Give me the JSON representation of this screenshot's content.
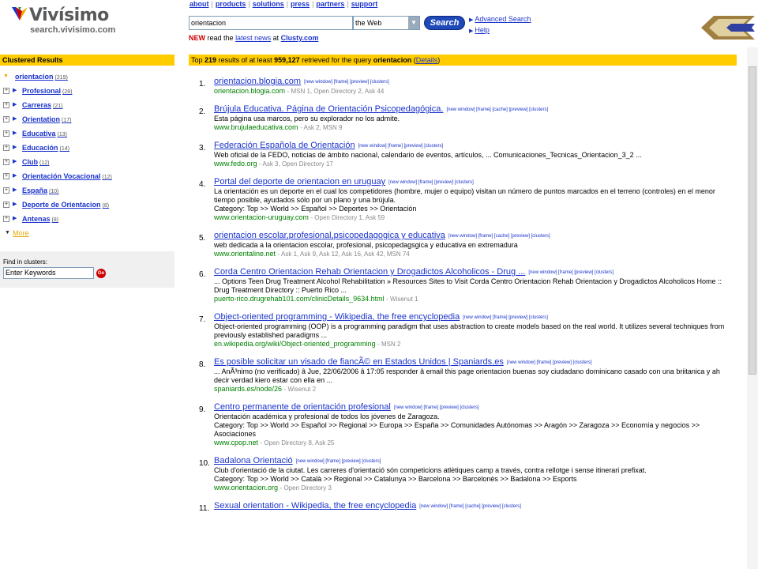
{
  "brand": {
    "name": "Vivísimo",
    "subdomain": "search.vivisimo.com"
  },
  "topnav": [
    "about",
    "products",
    "solutions",
    "press",
    "partners",
    "support"
  ],
  "search": {
    "query": "orientacion",
    "scope": "the Web",
    "button": "Search"
  },
  "side_links": [
    "Advanced Search",
    "Help"
  ],
  "news": {
    "new_label": "NEW",
    "prefix": "read the",
    "link": "latest news",
    "at": "at",
    "site": "Clusty.com"
  },
  "sidebar": {
    "header": "Clustered Results",
    "root": {
      "label": "orientacion",
      "count": "(219)"
    },
    "clusters": [
      {
        "label": "Profesional",
        "count": "(28)"
      },
      {
        "label": "Carreras",
        "count": "(21)"
      },
      {
        "label": "Orientation",
        "count": "(17)"
      },
      {
        "label": "Educativa",
        "count": "(13)"
      },
      {
        "label": "Educación",
        "count": "(14)"
      },
      {
        "label": "Club",
        "count": "(12)"
      },
      {
        "label": "Orientación Vocacional",
        "count": "(12)"
      },
      {
        "label": "España",
        "count": "(10)"
      },
      {
        "label": "Deporte de Orientacion",
        "count": "(8)"
      },
      {
        "label": "Antenas",
        "count": "(8)"
      }
    ],
    "more": "More",
    "find_label": "Find in clusters:",
    "find_placeholder": "Enter Keywords"
  },
  "results_header": {
    "prefix": "Top",
    "top": "219",
    "mid": "results of at least",
    "total": "959,127",
    "suffix": "retrieved for the query",
    "query": "orientacion",
    "details": "Details"
  },
  "results": [
    {
      "num": "1.",
      "title": "orientacion.blogia.com",
      "links": "[new window] [frame] [preview] [clusters]",
      "snippet": "",
      "url": "orientacion.blogia.com",
      "sources": "- MSN 1, Open Directory 2, Ask 44"
    },
    {
      "num": "2.",
      "title": "Brújula Educativa. Página de Orientación Psicopedagógica.",
      "links": "[new window] [frame] [cache] [preview] [clusters]",
      "snippet": "Esta página usa marcos, pero su explorador no los admite.",
      "url": "www.brujulaeducativa.com",
      "sources": "- Ask 2, MSN 9"
    },
    {
      "num": "3.",
      "title": "Federación Española de Orientación",
      "links": "[new window] [frame] [preview] [clusters]",
      "snippet": "Web oficial de la FEDO, noticias de ámbito nacional, calendario de eventos, artículos, ... Comunicaciones_Tecnicas_Orientacion_3_2 ...",
      "url": "www.fedo.org",
      "sources": "- Ask 3, Open Directory 17"
    },
    {
      "num": "4.",
      "title": "Portal del deporte de orientacion en uruguay",
      "links": "[new window] [frame] [preview] [clusters]",
      "snippet": "La orientación es un deporte en el cual los competidores (hombre, mujer o equipo) visitan un número de puntos marcados en el terreno (controles) en el menor tiempo posible, ayudados sólo por un plano y una brújula.",
      "category": "Category: Top >> World >> Español >> Deportes >> Orientación",
      "url": "www.orientacion-uruguay.com",
      "sources": "- Open Directory 1, Ask 59"
    },
    {
      "num": "5.",
      "title": "orientacion escolar,profesional,psicopedagogica y educativa",
      "links": "[new window] [frame] [cache] [preview] [clusters]",
      "snippet": "web dedicada a la orientacion escolar, profesional, psicopedagsgica y educativa en extremadura",
      "url": "www.orientaline.net",
      "sources": "- Ask 1, Ask 9, Ask 12, Ask 16, Ask 42, MSN 74"
    },
    {
      "num": "6.",
      "title": "Corda Centro Orientacion Rehab Orientacion y Drogadictos Alcoholicos - Drug ...",
      "links": "[new window] [frame] [preview] [clusters]",
      "snippet": "... Options Teen Drug Treatment Alcohol Rehabilitation » Resources Sites to Visit Corda Centro Orientacion Rehab Orientacion y Drogadictos Alcoholicos Home :: Drug Treatment Directory :: Puerto Rico ...",
      "url": "puerto-rico.drugrehab101.com/clinicDetails_9634.html",
      "sources": "- Wisenut 1"
    },
    {
      "num": "7.",
      "title": "Object-oriented programming - Wikipedia, the free encyclopedia",
      "links": "[new window] [frame] [preview] [clusters]",
      "snippet": "Object-oriented programming (OOP) is a programming paradigm that uses abstraction to create models based on the real world. It utilizes several techniques from previously established paradigms ...",
      "url": "en.wikipedia.org/wiki/Object-oriented_programming",
      "sources": "- MSN 2"
    },
    {
      "num": "8.",
      "title": "Es posible solicitar un visado de fiancÃ© en Estados Unidos | Spaniards.es",
      "links": "[new window] [frame] [preview] [clusters]",
      "snippet": "... AnÃ³nimo (no verificado) â Jue, 22/06/2006 â 17:05 responder â email this page orientacion buenas soy ciudadano dominicano casado con una briitanica y ah decir verdad kiero estar con ella en ...",
      "url": "spaniards.es/node/26",
      "sources": "- Wisenut 2"
    },
    {
      "num": "9.",
      "title": "Centro permanente de orientación profesional",
      "links": "[new window] [frame] [preview] [clusters]",
      "snippet": "Orientación académica y profesional de todos los jóvenes de Zaragoza.",
      "category": "Category: Top >> World >> Español >> Regional >> Europa >> España >> Comunidades Autónomas >> Aragón >> Zaragoza >> Economía y negocios >> Asociaciones",
      "url": "www.cpop.net",
      "sources": "- Open Directory 8, Ask 25"
    },
    {
      "num": "10.",
      "title": "Badalona Orientació",
      "links": "[new window] [frame] [preview] [clusters]",
      "snippet": "Club d'orientació de la ciutat. Les carreres d'orientació són competicions atlètiques camp a través, contra rellotge i sense itinerari prefixat.",
      "category": "Category: Top >> World >> Català >> Regional >> Catalunya >> Barcelona >> Barcelonès >> Badalona >> Esports",
      "url": "www.orientacion.org",
      "sources": "- Open Directory 3"
    },
    {
      "num": "11.",
      "title": "Sexual orientation - Wikipedia, the free encyclopedia",
      "links": "[new window] [frame] [cache] [preview] [clusters]",
      "snippet": "",
      "url": "",
      "sources": ""
    }
  ]
}
